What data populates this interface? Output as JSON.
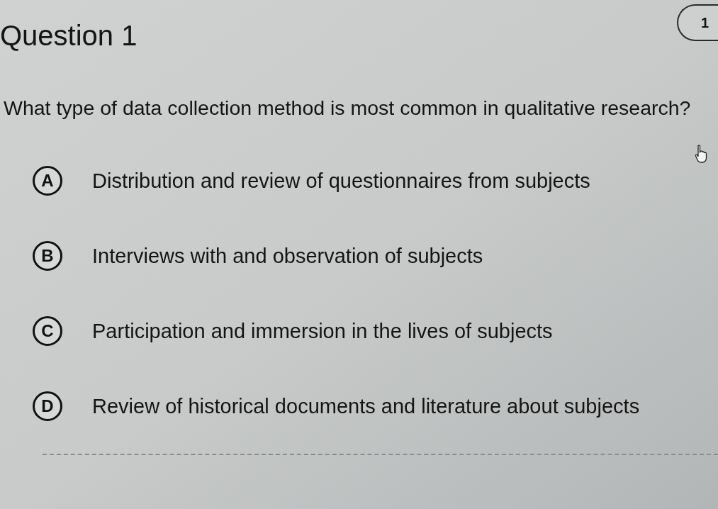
{
  "header": {
    "title": "Question 1",
    "points_badge": "1"
  },
  "question": {
    "text": "What type of data collection method is most common in qualitative research?"
  },
  "options": [
    {
      "letter": "A",
      "text": "Distribution and review of questionnaires from subjects",
      "selected": false
    },
    {
      "letter": "B",
      "text": "Interviews with and observation of subjects",
      "selected": false
    },
    {
      "letter": "C",
      "text": "Participation and immersion in the lives of subjects",
      "selected": false
    },
    {
      "letter": "D",
      "text": "Review of historical documents and literature about subjects",
      "selected": false
    }
  ]
}
